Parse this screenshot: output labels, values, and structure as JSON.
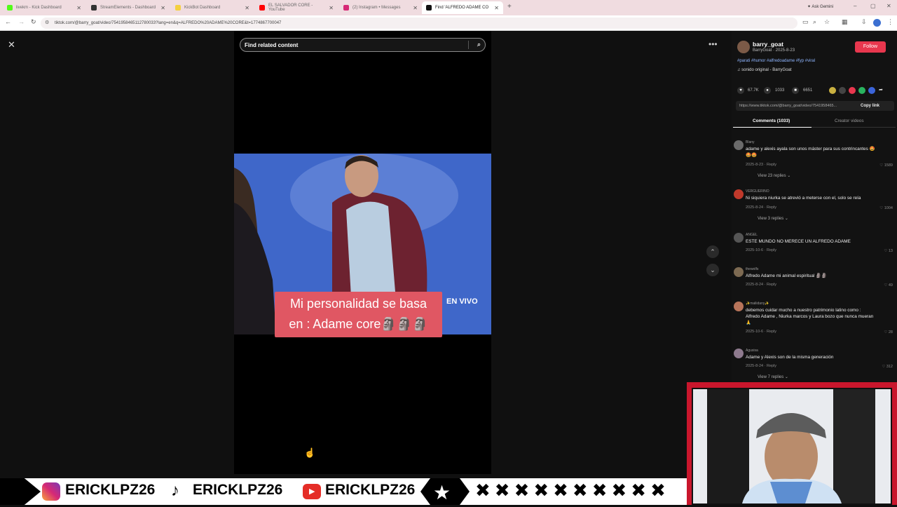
{
  "browser": {
    "tabs": [
      {
        "label": "livekm - Kick Dashboard",
        "color": "#53fc18"
      },
      {
        "label": "StreamElements - Dashboard",
        "color": "#333333"
      },
      {
        "label": "KickBot Dashboard",
        "color": "#f4d03f"
      },
      {
        "label": "EL SALVADOR CORE - YouTube",
        "color": "#ff0000"
      },
      {
        "label": "(2) Instagram • Messages",
        "color": "#d62976"
      },
      {
        "label": "Find 'ALFREDO ADAME CO",
        "color": "#111111"
      }
    ],
    "new_tab": "+",
    "ask_gemini": "Ask Gemini",
    "url": "tiktok.com/@barry_goat/video/7541958465112780033?lang=en&q=ALFREDO%20ADAME%20CORE&t=1774867700047"
  },
  "player": {
    "search_placeholder": "Find related content",
    "caption_line1": "Mi personalidad se basa",
    "caption_line2": "en : Adame core🗿🗿🗿",
    "live_label": "EN VIVO"
  },
  "author": {
    "name": "barry_goat",
    "sub": "BarryGoat · 2025-8-23",
    "follow": "Follow",
    "hashtags": "#parati #humor #alfredoadame #fyp #viral",
    "sound": "♫ sonido original - BarryGoat",
    "likes": "67.7K",
    "comments": "1033",
    "saves": "6651",
    "link": "https://www.tiktok.com/@barry_goat/video/7541958465...",
    "copy": "Copy link"
  },
  "tabs": {
    "comments": "Comments (1033)",
    "creator": "Creator videos"
  },
  "comments": [
    {
      "user": "Blany",
      "text": "adame y alexis ayala son unos máster para sus contrincantes 🤩🤩🤩",
      "date": "2025-8-23",
      "reply": "Reply",
      "likes": "1589",
      "replies": "View 23 replies ⌄",
      "avatar": "#6b6b6b"
    },
    {
      "user": "VERGUERINO",
      "text": "Ni siquiera niurka se atrevió a meterse con el, solo se reía",
      "date": "2025-8-24",
      "reply": "Reply",
      "likes": "1004",
      "replies": "View 3 replies ⌄",
      "avatar": "#c0392b"
    },
    {
      "user": "ANGEL",
      "text": "ESTE MUNDO NO MERECE UN ALFREDO ADAME",
      "date": "2025-10-6",
      "reply": "Reply",
      "likes": "13",
      "replies": "",
      "avatar": "#555555"
    },
    {
      "user": "thewolfs",
      "text": "Alfredo Adame mi animal espiritual 🗿🗿",
      "date": "2025-8-24",
      "reply": "Reply",
      "likes": "49",
      "replies": "",
      "avatar": "#7d6a52"
    },
    {
      "user": "✨maliidany✨",
      "text": "debemos cuidar mucho a nuestro patrimonio latino como : Alfredo Adame , Niurka marcos y Laura bozo que nunca mueran 🙏",
      "date": "2025-10-6",
      "reply": "Reply",
      "likes": "28",
      "replies": "",
      "avatar": "#b7745a"
    },
    {
      "user": "Agusisa",
      "text": "Adame y Alexis son de la misma generación",
      "date": "2025-8-24",
      "reply": "Reply",
      "likes": "312",
      "replies": "View 7 replies ⌄",
      "avatar": "#8e7a8e"
    }
  ],
  "banner": {
    "handle1": "ERICKLPZ26",
    "handle2": "ERICKLPZ26",
    "handle3": "ERICKLPZ26"
  }
}
